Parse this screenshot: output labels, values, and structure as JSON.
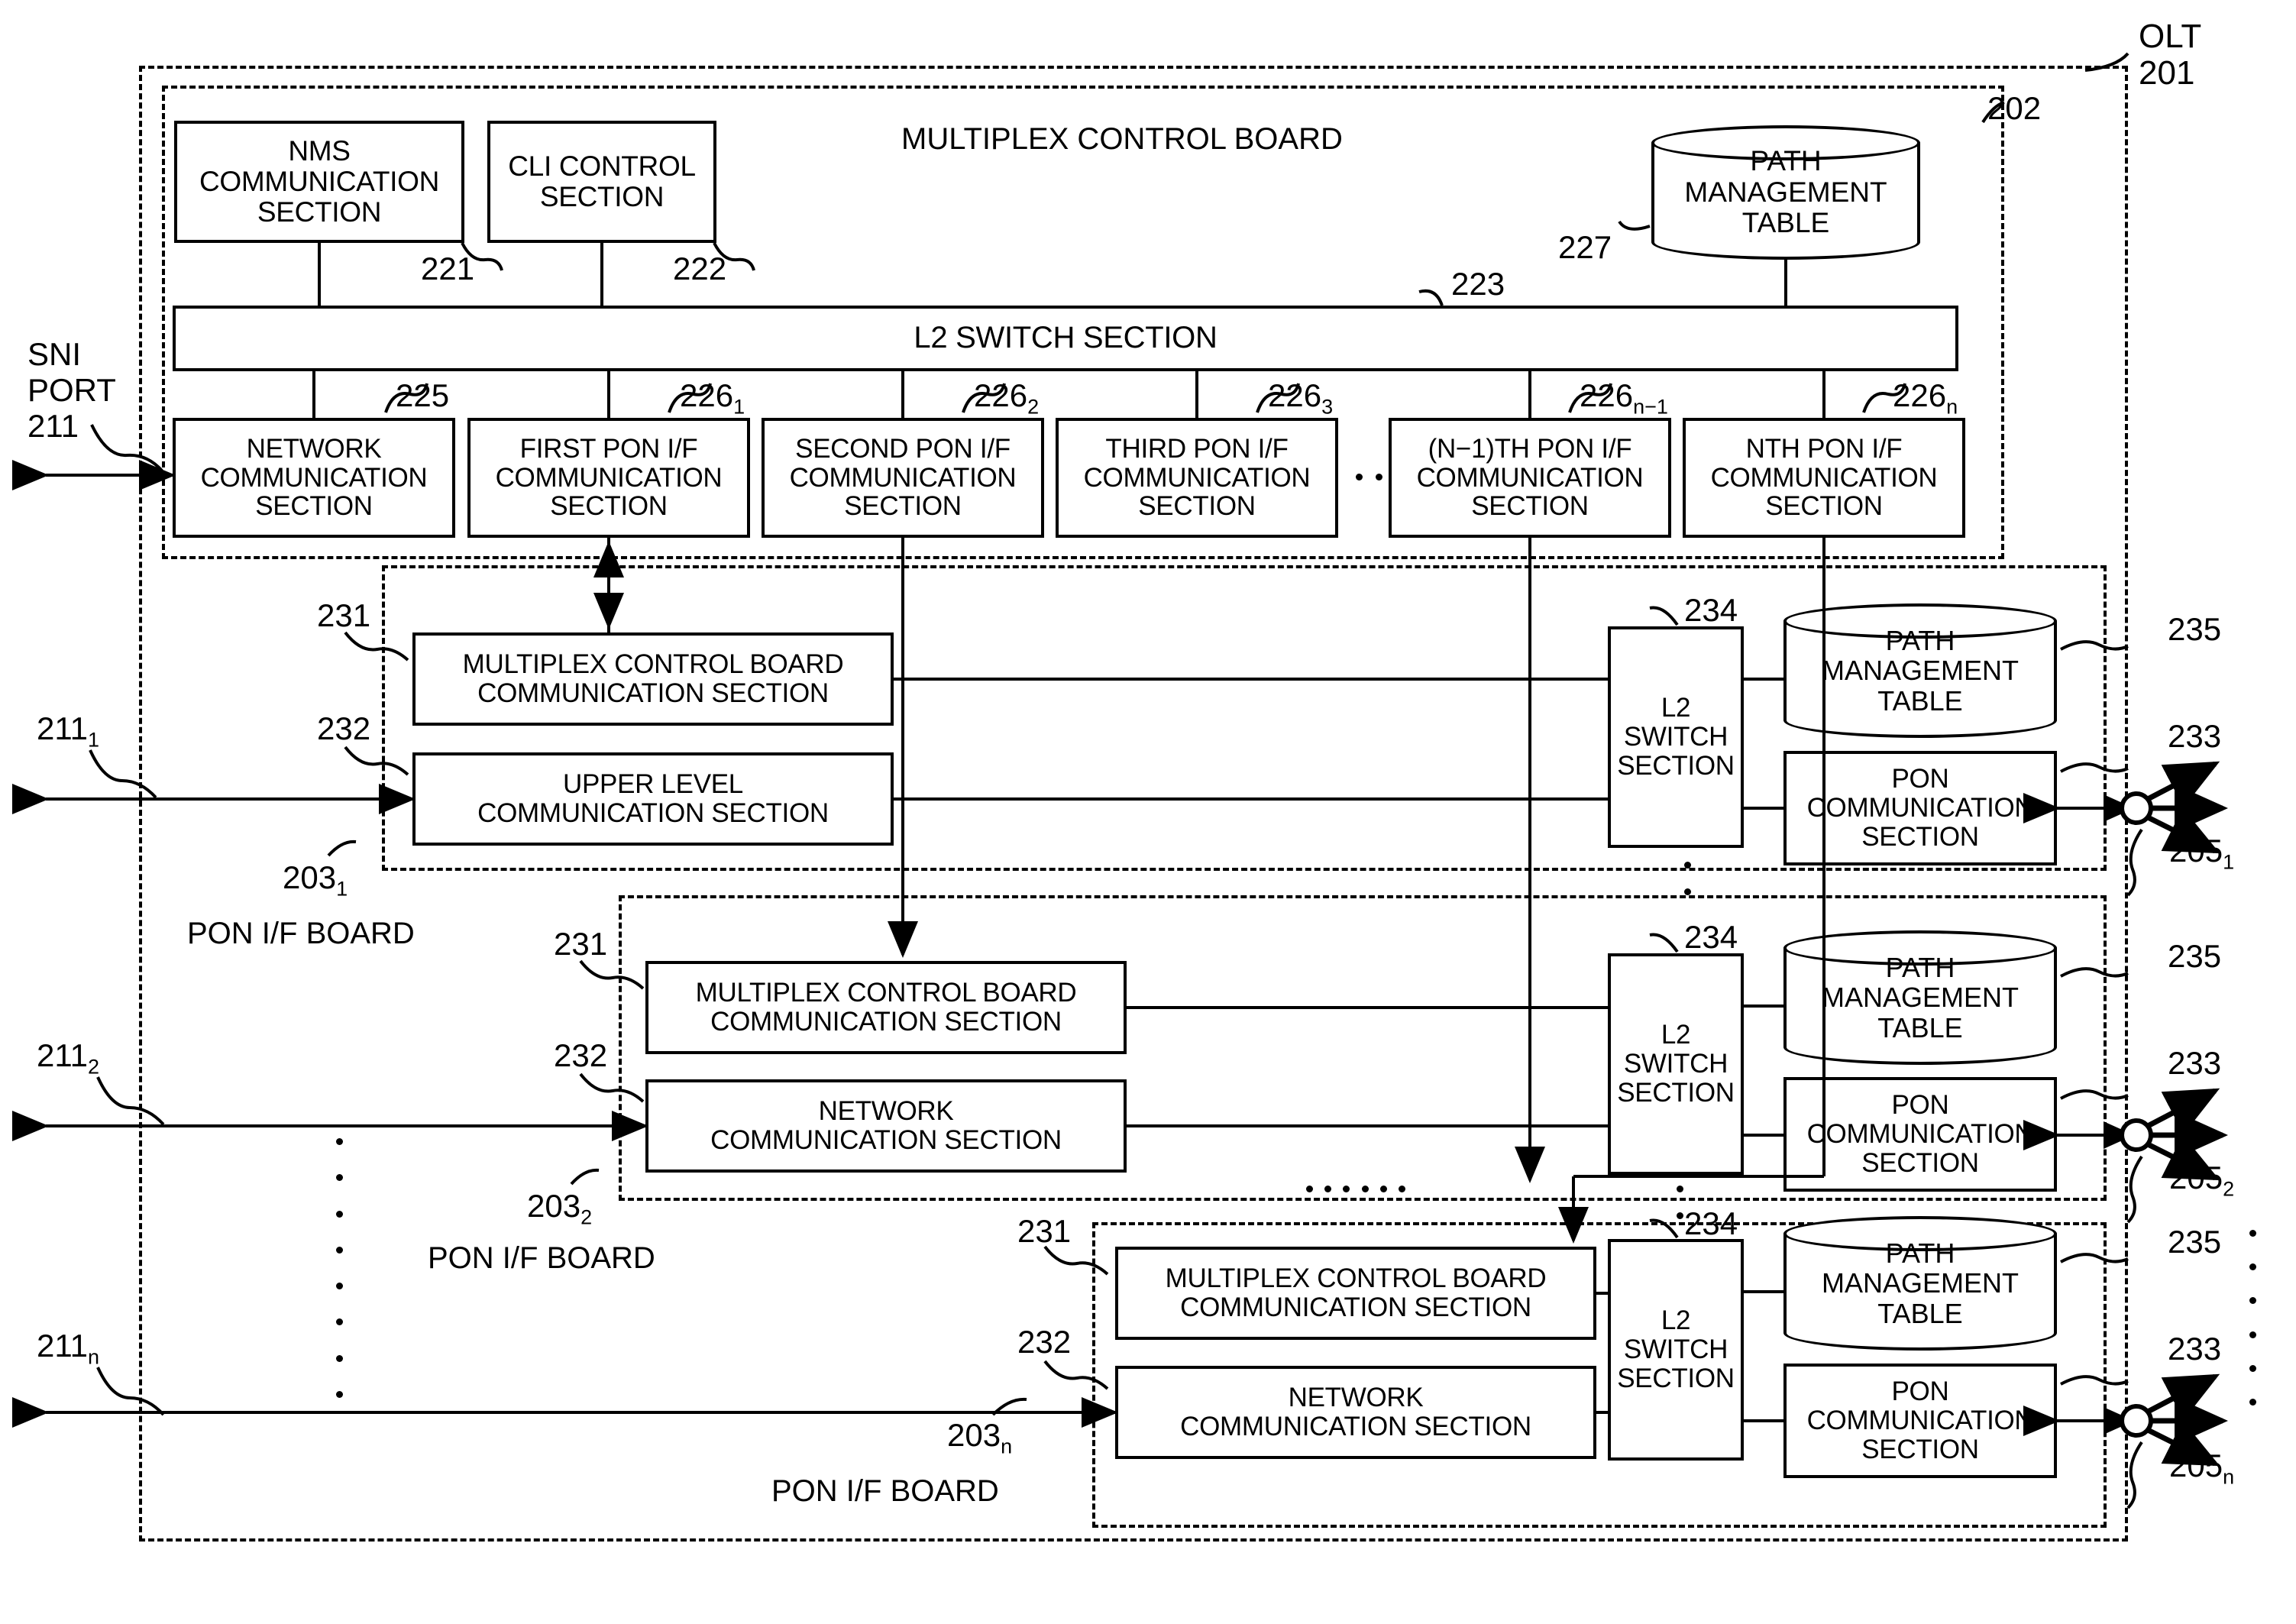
{
  "figure": {
    "device_label": "OLT",
    "device_ref": "201",
    "multiplex_board_ref": "202",
    "sni_port_label_line1": "SNI",
    "sni_port_label_line2": "PORT",
    "sni_port_ref": "211"
  },
  "multiplex_board": {
    "title": "MULTIPLEX CONTROL BOARD",
    "nms": {
      "label": "NMS\nCOMMUNICATION\nSECTION",
      "ref": "221"
    },
    "cli": {
      "label": "CLI CONTROL\nSECTION",
      "ref": "222"
    },
    "path_table": {
      "label": "PATH\nMANAGEMENT\nTABLE",
      "ref": "227"
    },
    "l2switch": {
      "label": "L2 SWITCH SECTION",
      "ref": "223"
    },
    "comm_sections": [
      {
        "label": "NETWORK\nCOMMUNICATION\nSECTION",
        "ref": "225",
        "sub": ""
      },
      {
        "label": "FIRST PON I/F\nCOMMUNICATION\nSECTION",
        "ref": "226",
        "sub": "1"
      },
      {
        "label": "SECOND PON I/F\nCOMMUNICATION\nSECTION",
        "ref": "226",
        "sub": "2"
      },
      {
        "label": "THIRD PON I/F\nCOMMUNICATION\nSECTION",
        "ref": "226",
        "sub": "3"
      },
      {
        "label": "(N−1)TH PON I/F\nCOMMUNICATION\nSECTION",
        "ref": "226",
        "sub": "n−1"
      },
      {
        "label": "NTH PON I/F\nCOMMUNICATION\nSECTION",
        "ref": "226",
        "sub": "n"
      }
    ]
  },
  "pon_boards": [
    {
      "board_label": "PON I/F BOARD",
      "board_ref": "203",
      "board_sub": "1",
      "port_ref": "211",
      "port_sub": "1",
      "mcb_comm": {
        "label": "MULTIPLEX CONTROL BOARD\nCOMMUNICATION SECTION",
        "ref": "231"
      },
      "net_comm": {
        "label": "UPPER LEVEL\nCOMMUNICATION SECTION",
        "ref": "232"
      },
      "l2switch": {
        "label": "L2\nSWITCH\nSECTION",
        "ref": "234"
      },
      "path_table": {
        "label": "PATH\nMANAGEMENT\nTABLE",
        "ref": "235"
      },
      "pon_comm": {
        "label": "PON\nCOMMUNICATION\nSECTION",
        "ref": "233"
      },
      "splitter_ref": "205",
      "splitter_sub": "1"
    },
    {
      "board_label": "PON I/F BOARD",
      "board_ref": "203",
      "board_sub": "2",
      "port_ref": "211",
      "port_sub": "2",
      "mcb_comm": {
        "label": "MULTIPLEX CONTROL BOARD\nCOMMUNICATION SECTION",
        "ref": "231"
      },
      "net_comm": {
        "label": "NETWORK\nCOMMUNICATION SECTION",
        "ref": "232"
      },
      "l2switch": {
        "label": "L2\nSWITCH\nSECTION",
        "ref": "234"
      },
      "path_table": {
        "label": "PATH\nMANAGEMENT\nTABLE",
        "ref": "235"
      },
      "pon_comm": {
        "label": "PON\nCOMMUNICATION\nSECTION",
        "ref": "233"
      },
      "splitter_ref": "205",
      "splitter_sub": "2"
    },
    {
      "board_label": "PON I/F BOARD",
      "board_ref": "203",
      "board_sub": "n",
      "port_ref": "211",
      "port_sub": "n",
      "mcb_comm": {
        "label": "MULTIPLEX CONTROL BOARD\nCOMMUNICATION SECTION",
        "ref": "231"
      },
      "net_comm": {
        "label": "NETWORK\nCOMMUNICATION SECTION",
        "ref": "232"
      },
      "l2switch": {
        "label": "L2\nSWITCH\nSECTION",
        "ref": "234"
      },
      "path_table": {
        "label": "PATH\nMANAGEMENT\nTABLE",
        "ref": "235"
      },
      "pon_comm": {
        "label": "PON\nCOMMUNICATION\nSECTION",
        "ref": "233"
      },
      "splitter_ref": "205",
      "splitter_sub": "n"
    }
  ]
}
